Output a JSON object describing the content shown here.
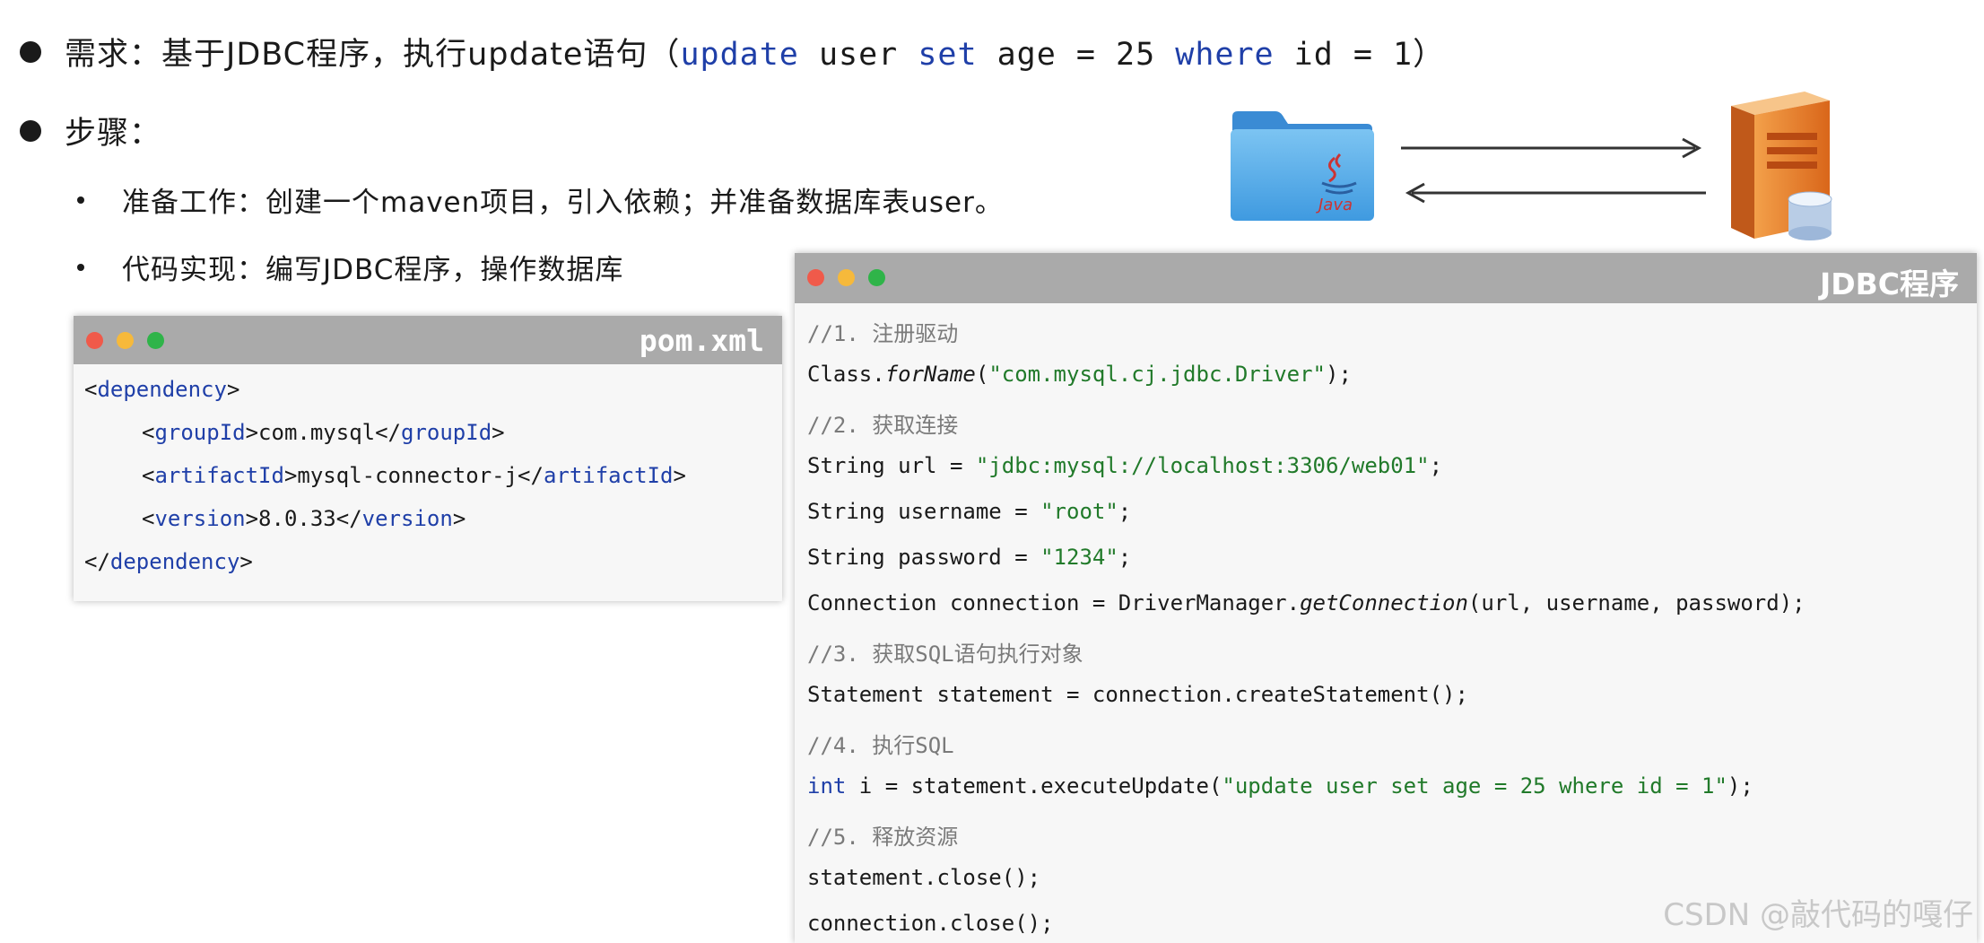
{
  "bullets": {
    "requirement": {
      "label": "需求：基于JDBC程序，执行update语句（",
      "code_kw_update": "update",
      "code_user": " user ",
      "code_kw_set": "set",
      "code_age": " age = 25 ",
      "code_kw_where": "where",
      "code_id": " id = 1",
      "close_paren": "）"
    },
    "steps_label": "步骤：",
    "sub_items": [
      "准备工作：创建一个maven项目，引入依赖；并准备数据库表user。",
      "代码实现：编写JDBC程序，操作数据库"
    ]
  },
  "diagram": {
    "folder_icon": "java-folder-icon",
    "folder_label": "Java",
    "server_icon": "database-server-icon",
    "arrow_right": "arrow-right-icon",
    "arrow_left": "arrow-left-icon"
  },
  "pom_window": {
    "title": "pom.xml",
    "lines": {
      "l1_open": "<",
      "l1_tag": "dependency",
      "l1_close": ">",
      "l2_open": "<",
      "l2_tag": "groupId",
      "l2_mid": ">com.mysql</",
      "l2_tag2": "groupId",
      "l2_close": ">",
      "l3_open": "<",
      "l3_tag": "artifactId",
      "l3_mid": ">mysql-connector-j</",
      "l3_tag2": "artifactId",
      "l3_close": ">",
      "l4_open": "<",
      "l4_tag": "version",
      "l4_mid": ">8.0.33</",
      "l4_tag2": "version",
      "l4_close": ">",
      "l5_open": "</",
      "l5_tag": "dependency",
      "l5_close": ">"
    }
  },
  "jdbc_window": {
    "title": "JDBC程序",
    "c1": "//1. 注册驱动",
    "l2_a": "Class.",
    "l2_b": "forName",
    "l2_c": "(",
    "l2_str": "\"com.mysql.cj.jdbc.Driver\"",
    "l2_d": ");",
    "c3": "//2. 获取连接",
    "l4_a": "String url = ",
    "l4_str": "\"jdbc:mysql://localhost:3306/web01\"",
    "l4_b": ";",
    "l5_a": "String username = ",
    "l5_str": "\"root\"",
    "l5_b": ";",
    "l6_a": "String password = ",
    "l6_str": "\"1234\"",
    "l6_b": ";",
    "l7_a": "Connection connection = DriverManager.",
    "l7_b": "getConnection",
    "l7_c": "(url, username, password);",
    "c8": "//3. 获取SQL语句执行对象",
    "l9": "Statement statement = connection.createStatement();",
    "c10": "//4. 执行SQL",
    "l11_kw": "int",
    "l11_a": " i = statement.executeUpdate(",
    "l11_str": "\"update user set age = 25 where id = 1\"",
    "l11_b": ");",
    "c12": "//5. 释放资源",
    "l13": "statement.close();",
    "l14": "connection.close();"
  },
  "watermark": "CSDN @敲代码的嘎仔"
}
